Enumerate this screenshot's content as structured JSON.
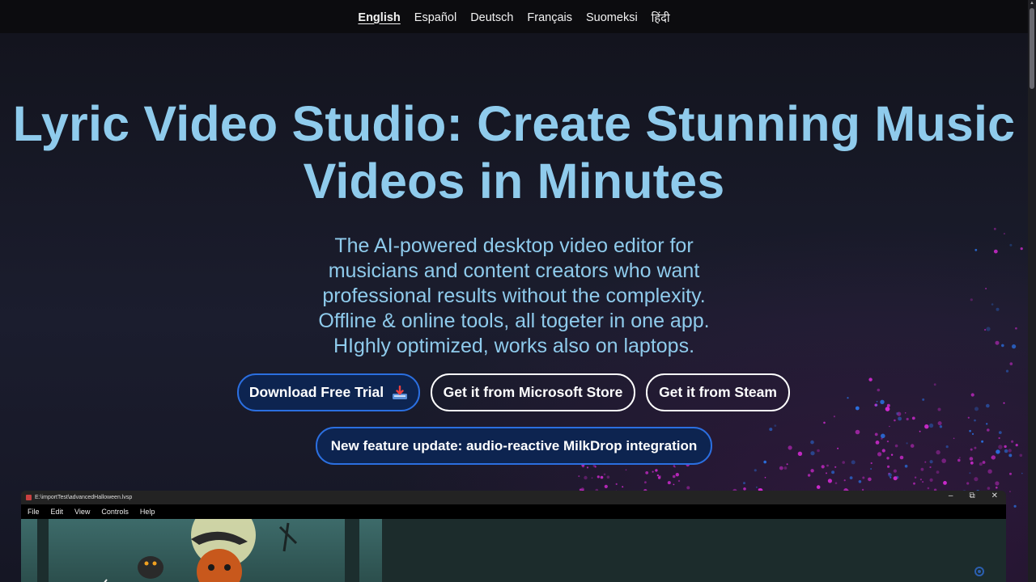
{
  "nav": {
    "languages": [
      {
        "label": "English",
        "active": true
      },
      {
        "label": "Español",
        "active": false
      },
      {
        "label": "Deutsch",
        "active": false
      },
      {
        "label": "Français",
        "active": false
      },
      {
        "label": "Suomeksi",
        "active": false
      },
      {
        "label": "हिंदी",
        "active": false
      }
    ]
  },
  "hero": {
    "title_line1": "Lyric Video Studio: Create Stunning Music",
    "title_line2": "Videos in Minutes",
    "subtitle_lines": [
      "The AI-powered desktop video editor for",
      "musicians and content creators who want",
      "professional results without the complexity.",
      "Offline & online tools, all togeter in one app.",
      "HIghly optimized, works also on laptops."
    ]
  },
  "buttons": {
    "download": "Download Free Trial",
    "download_icon": "download-tray-icon",
    "microsoft": "Get it from Microsoft Store",
    "steam": "Get it from Steam",
    "feature": "New feature update: audio-reactive MilkDrop integration"
  },
  "app_window": {
    "title": "E:\\importTest\\advancedHalloween.lvsp",
    "menu": [
      "File",
      "Edit",
      "View",
      "Controls",
      "Help"
    ],
    "window_controls": [
      "–",
      "⧉",
      "✕"
    ]
  },
  "colors": {
    "accent": "#8fcbec",
    "button_primary_bg": "#0d2450",
    "button_primary_border": "#2b6fe0",
    "topbar_bg": "#0c0c0f",
    "particle_magenta": "#d02ad0",
    "particle_blue": "#2a6fe0"
  }
}
